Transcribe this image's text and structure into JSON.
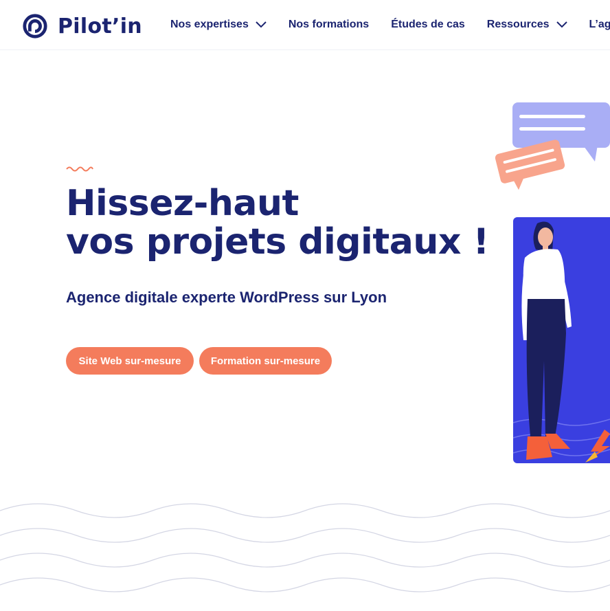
{
  "brand": {
    "name": "Pilot’in",
    "accent": "#f47c5c",
    "primary": "#1b2470",
    "illustration_bg": "#3a3fe0"
  },
  "nav": {
    "items": [
      {
        "label": "Nos expertises",
        "has_dropdown": true
      },
      {
        "label": "Nos formations",
        "has_dropdown": false
      },
      {
        "label": "Études de cas",
        "has_dropdown": false
      },
      {
        "label": "Ressources",
        "has_dropdown": true
      },
      {
        "label": "L’agence",
        "has_dropdown": false
      }
    ]
  },
  "hero": {
    "title_line1": "Hissez-haut",
    "title_line2": "vos projets digitaux !",
    "subtitle": "Agence digitale experte WordPress sur Lyon",
    "buttons": [
      {
        "label": "Site Web sur-mesure"
      },
      {
        "label": "Formation sur-mesure"
      }
    ]
  },
  "icons": {
    "logo": "pilotin-logo-icon",
    "chevron": "chevron-down-icon",
    "squiggle": "squiggle-icon"
  }
}
